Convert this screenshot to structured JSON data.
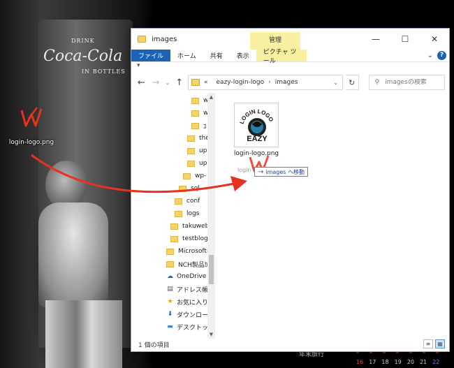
{
  "desktop": {
    "fridge_small": "DRINK",
    "fridge_brand": "Coca-Cola",
    "fridge_bottles": "IN BOTTLES",
    "icon_label": "login-logo.png",
    "taskbar_text": "年末旅行",
    "calendar_dates": [
      "16",
      "17",
      "18",
      "19",
      "20",
      "21",
      "22"
    ]
  },
  "window": {
    "title": "images",
    "context_group": "管理",
    "controls": [
      "—",
      "☐",
      "✕"
    ],
    "ribbon_tabs": [
      "ファイル",
      "ホーム",
      "共有",
      "表示"
    ],
    "context_tab": "ピクチャ ツール",
    "quick_access": "▾",
    "nav": {
      "back": "←",
      "forward": "→",
      "recent": "⌄",
      "up": "↑"
    },
    "address": {
      "prefix": "«",
      "segments": [
        "eazy-login-logo",
        "images"
      ],
      "dropdown": "⌄"
    },
    "refresh": "↻",
    "search_placeholder": "imagesの検索",
    "nav_items": [
      {
        "label": "w",
        "type": "folder"
      },
      {
        "label": "w",
        "type": "folder"
      },
      {
        "label": "ﾕ",
        "type": "folder"
      },
      {
        "label": "the",
        "type": "folder"
      },
      {
        "label": "up",
        "type": "folder"
      },
      {
        "label": "up",
        "type": "folder"
      },
      {
        "label": "wp-",
        "type": "folder"
      },
      {
        "label": "sql",
        "type": "folder"
      },
      {
        "label": "conf",
        "type": "folder"
      },
      {
        "label": "logs",
        "type": "folder"
      },
      {
        "label": "takuweb",
        "type": "folder"
      },
      {
        "label": "testblog",
        "type": "folder"
      },
      {
        "label": "MicrosoftE",
        "type": "folder"
      },
      {
        "label": "NCH製品ｶ",
        "type": "folder"
      },
      {
        "label": "OneDrive",
        "type": "onedrive"
      },
      {
        "label": "アドレス帳",
        "type": "contacts"
      },
      {
        "label": "お気に入り",
        "type": "star"
      },
      {
        "label": "ダウンロード",
        "type": "download"
      },
      {
        "label": "デスクトップ",
        "type": "desktop"
      }
    ],
    "files": [
      {
        "name": "login-logo.png",
        "thumb_text_top": "LOGIN LOGO",
        "thumb_text_mid": "EAZY"
      }
    ],
    "drag": {
      "ghost_label": "login",
      "tooltip_arrow": "→",
      "tooltip_text": "images へ移動"
    },
    "status": "1 個の項目",
    "view_buttons": [
      "≡",
      "▦"
    ]
  },
  "colors": {
    "accent": "#1c63b7",
    "context_tab": "#f7f0a0",
    "folder": "#f6d365",
    "drag_arrow": "#e8321f"
  }
}
